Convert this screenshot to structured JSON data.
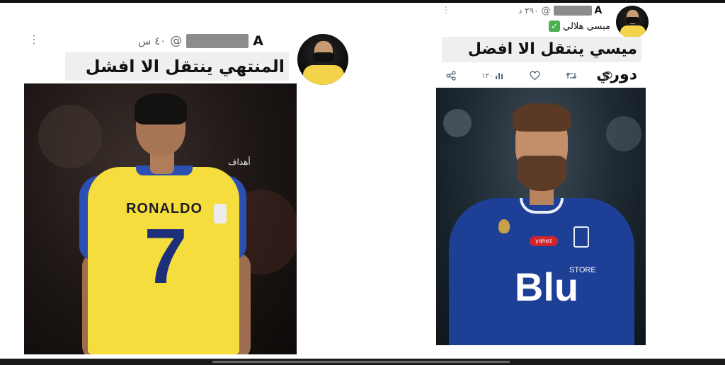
{
  "left_tweet": {
    "handle_letter": "A",
    "at_sign": "@",
    "time": "٤٠ س",
    "caption": "المنتهي ينتقل الا افشل دوري",
    "menu_glyph": "⋮",
    "photo": {
      "jersey_name": "RONALDO",
      "jersey_number": "7",
      "watermark": "أهداف",
      "shirt_color": "#f4dd3c",
      "trim_color": "#2c4fb2"
    }
  },
  "right_tweet": {
    "handle_letter": "A",
    "at_sign": "@",
    "time": "٢٩٠ د",
    "display_name": "ميسي هلالي",
    "verified_glyph": "✓",
    "caption": "ميسي ينتقل الا افضل دوري",
    "menu_glyph": "⋮",
    "actions": {
      "share_icon": "share-icon",
      "views_icon": "views-icon",
      "views_count": "١٢٠",
      "like_icon": "heart-icon",
      "retweet_icon": "retweet-icon",
      "reply_icon": "reply-icon"
    },
    "photo": {
      "sponsor_text": "Blu",
      "store_text": "STORE",
      "sleeve_sponsor": "yahez",
      "shirt_color": "#1d3f96"
    }
  }
}
